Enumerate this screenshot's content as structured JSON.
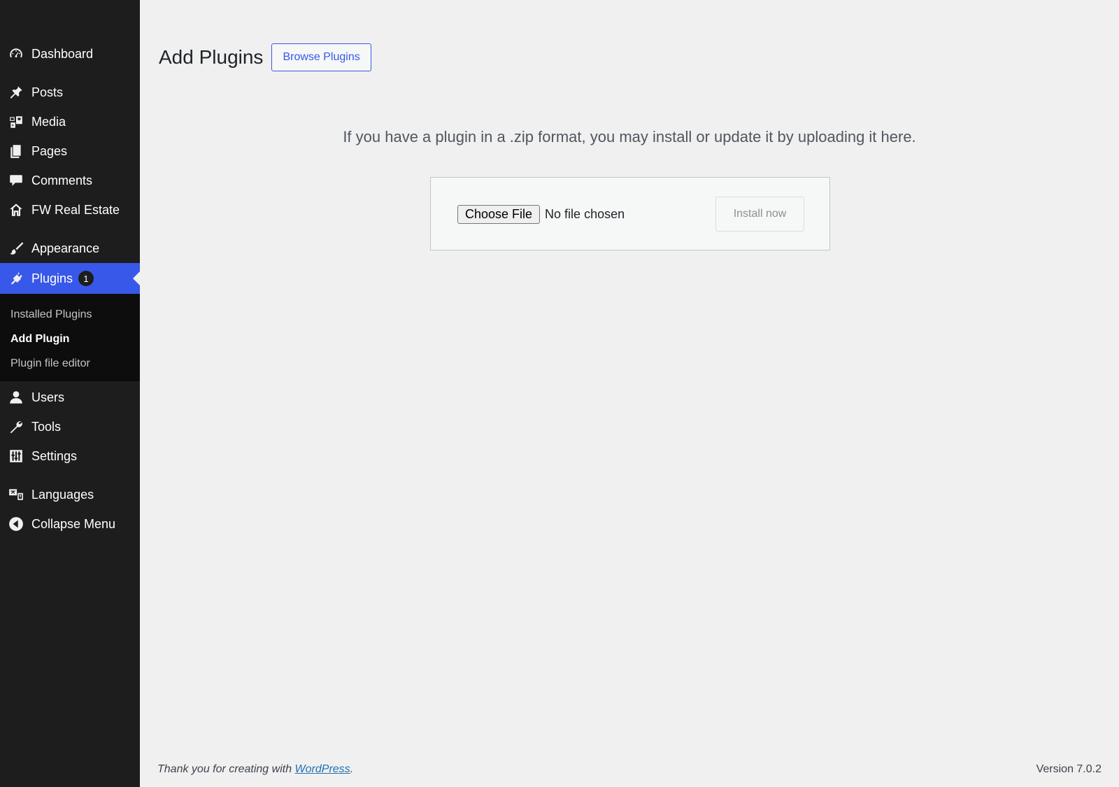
{
  "sidebar": {
    "items": [
      {
        "label": "Dashboard",
        "icon": "dashboard-icon"
      },
      {
        "label": "Posts",
        "icon": "pushpin-icon"
      },
      {
        "label": "Media",
        "icon": "media-icon"
      },
      {
        "label": "Pages",
        "icon": "pages-icon"
      },
      {
        "label": "Comments",
        "icon": "comment-icon"
      },
      {
        "label": "FW Real Estate",
        "icon": "house-icon"
      },
      {
        "label": "Appearance",
        "icon": "paintbrush-icon"
      },
      {
        "label": "Plugins",
        "icon": "plugin-icon",
        "badge": "1"
      },
      {
        "label": "Users",
        "icon": "user-icon"
      },
      {
        "label": "Tools",
        "icon": "wrench-icon"
      },
      {
        "label": "Settings",
        "icon": "settings-sliders-icon"
      },
      {
        "label": "Languages",
        "icon": "translation-icon"
      },
      {
        "label": "Collapse Menu",
        "icon": "collapse-arrow-icon"
      }
    ],
    "submenu": [
      {
        "label": "Installed Plugins"
      },
      {
        "label": "Add Plugin"
      },
      {
        "label": "Plugin file editor"
      }
    ]
  },
  "header": {
    "title": "Add Plugins",
    "browse_label": "Browse Plugins"
  },
  "upload": {
    "help_text": "If you have a plugin in a .zip format, you may install or update it by uploading it here.",
    "choose_file_label": "Choose File",
    "file_status": "No file chosen",
    "install_label": "Install now"
  },
  "footer": {
    "thanks_prefix": "Thank you for creating with ",
    "wordpress_link": "WordPress",
    "thanks_suffix": ".",
    "version": "Version 7.0.2"
  },
  "colors": {
    "sidebar_bg": "#1d1d1d",
    "active_menu": "#3858e9",
    "content_bg": "#f0f0f1"
  }
}
